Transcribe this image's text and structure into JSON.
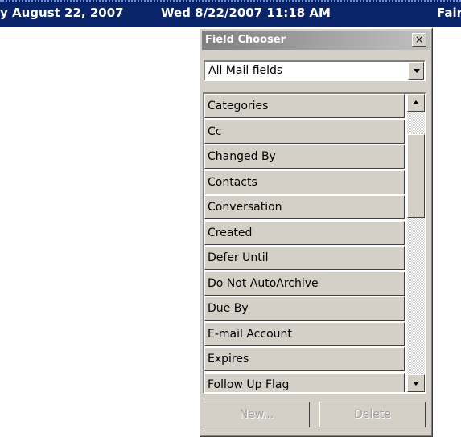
{
  "topbar": {
    "date_text": "y August 22, 2007",
    "datetime_text": "Wed 8/22/2007 11:18 AM",
    "trailing_text": "Fair"
  },
  "dialog": {
    "title": "Field Chooser",
    "close_glyph": "×",
    "category_select": {
      "value": "All Mail fields"
    },
    "fields": [
      "Categories",
      "Cc",
      "Changed By",
      "Contacts",
      "Conversation",
      "Created",
      "Defer Until",
      "Do Not AutoArchive",
      "Due By",
      "E-mail Account",
      "Expires",
      "Follow Up Flag"
    ],
    "buttons": {
      "new_label": "New...",
      "delete_label": "Delete"
    }
  },
  "colors": {
    "topbar_bg": "#0a246a",
    "dialog_face": "#d4d0c8",
    "disabled_text": "#a0a0a0"
  }
}
